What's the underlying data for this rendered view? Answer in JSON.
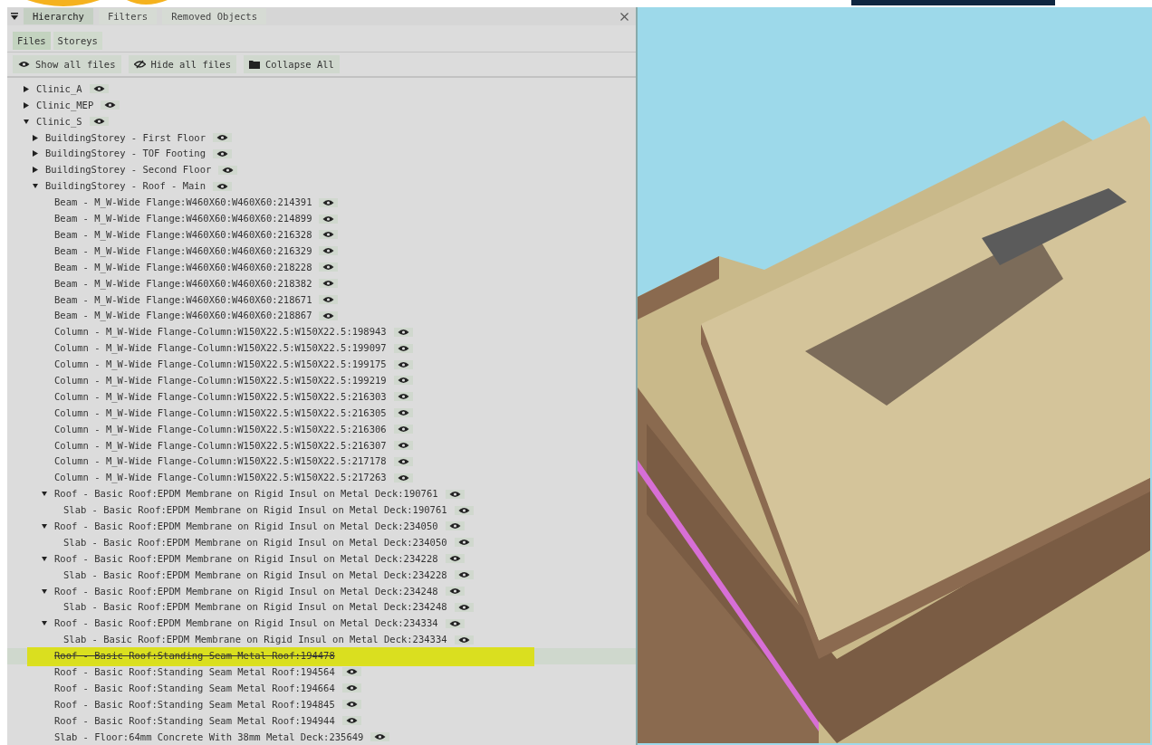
{
  "panel_tabs": [
    {
      "label": "Hierarchy",
      "selected": true
    },
    {
      "label": "Filters",
      "selected": false
    },
    {
      "label": "Removed Objects",
      "selected": false
    }
  ],
  "view_tabs": [
    {
      "label": "Files",
      "selected": true
    },
    {
      "label": "Storeys",
      "selected": false
    }
  ],
  "actions": [
    {
      "kind": "show",
      "label": "Show all files"
    },
    {
      "kind": "hide",
      "label": "Hide all files"
    },
    {
      "kind": "collapse",
      "label": "Collapse All"
    }
  ],
  "tree": [
    {
      "label": "Clinic_A",
      "expanded": false,
      "visible": true
    },
    {
      "label": "Clinic_MEP",
      "expanded": false,
      "visible": true
    },
    {
      "label": "Clinic_S",
      "expanded": true,
      "visible": true,
      "children": [
        {
          "label": "BuildingStorey - First Floor",
          "expanded": false,
          "visible": true
        },
        {
          "label": "BuildingStorey - TOF Footing",
          "expanded": false,
          "visible": true
        },
        {
          "label": "BuildingStorey - Second Floor",
          "expanded": false,
          "visible": true
        },
        {
          "label": "BuildingStorey - Roof - Main",
          "expanded": true,
          "visible": true,
          "children": [
            {
              "label": "Beam - M_W-Wide Flange:W460X60:W460X60:214391",
              "visible": true
            },
            {
              "label": "Beam - M_W-Wide Flange:W460X60:W460X60:214899",
              "visible": true
            },
            {
              "label": "Beam - M_W-Wide Flange:W460X60:W460X60:216328",
              "visible": true
            },
            {
              "label": "Beam - M_W-Wide Flange:W460X60:W460X60:216329",
              "visible": true
            },
            {
              "label": "Beam - M_W-Wide Flange:W460X60:W460X60:218228",
              "visible": true
            },
            {
              "label": "Beam - M_W-Wide Flange:W460X60:W460X60:218382",
              "visible": true
            },
            {
              "label": "Beam - M_W-Wide Flange:W460X60:W460X60:218671",
              "visible": true
            },
            {
              "label": "Beam - M_W-Wide Flange:W460X60:W460X60:218867",
              "visible": true
            },
            {
              "label": "Column - M_W-Wide Flange-Column:W150X22.5:W150X22.5:198943",
              "visible": true
            },
            {
              "label": "Column - M_W-Wide Flange-Column:W150X22.5:W150X22.5:199097",
              "visible": true
            },
            {
              "label": "Column - M_W-Wide Flange-Column:W150X22.5:W150X22.5:199175",
              "visible": true
            },
            {
              "label": "Column - M_W-Wide Flange-Column:W150X22.5:W150X22.5:199219",
              "visible": true
            },
            {
              "label": "Column - M_W-Wide Flange-Column:W150X22.5:W150X22.5:216303",
              "visible": true
            },
            {
              "label": "Column - M_W-Wide Flange-Column:W150X22.5:W150X22.5:216305",
              "visible": true
            },
            {
              "label": "Column - M_W-Wide Flange-Column:W150X22.5:W150X22.5:216306",
              "visible": true
            },
            {
              "label": "Column - M_W-Wide Flange-Column:W150X22.5:W150X22.5:216307",
              "visible": true
            },
            {
              "label": "Column - M_W-Wide Flange-Column:W150X22.5:W150X22.5:217178",
              "visible": true
            },
            {
              "label": "Column - M_W-Wide Flange-Column:W150X22.5:W150X22.5:217263",
              "visible": true
            },
            {
              "label": "Roof - Basic Roof:EPDM Membrane on Rigid Insul on Metal Deck:190761",
              "expanded": true,
              "visible": true,
              "children": [
                {
                  "label": "Slab - Basic Roof:EPDM Membrane on Rigid Insul on Metal Deck:190761",
                  "visible": true
                }
              ]
            },
            {
              "label": "Roof - Basic Roof:EPDM Membrane on Rigid Insul on Metal Deck:234050",
              "expanded": true,
              "visible": true,
              "children": [
                {
                  "label": "Slab - Basic Roof:EPDM Membrane on Rigid Insul on Metal Deck:234050",
                  "visible": true
                }
              ]
            },
            {
              "label": "Roof - Basic Roof:EPDM Membrane on Rigid Insul on Metal Deck:234228",
              "expanded": true,
              "visible": true,
              "children": [
                {
                  "label": "Slab - Basic Roof:EPDM Membrane on Rigid Insul on Metal Deck:234228",
                  "visible": true
                }
              ]
            },
            {
              "label": "Roof - Basic Roof:EPDM Membrane on Rigid Insul on Metal Deck:234248",
              "expanded": true,
              "visible": true,
              "children": [
                {
                  "label": "Slab - Basic Roof:EPDM Membrane on Rigid Insul on Metal Deck:234248",
                  "visible": true
                }
              ]
            },
            {
              "label": "Roof - Basic Roof:EPDM Membrane on Rigid Insul on Metal Deck:234334",
              "expanded": true,
              "visible": true,
              "children": [
                {
                  "label": "Slab - Basic Roof:EPDM Membrane on Rigid Insul on Metal Deck:234334",
                  "visible": true
                }
              ]
            },
            {
              "label": "Roof - Basic Roof:Standing Seam Metal Roof:194478",
              "visible": false,
              "selected": true,
              "highlighted": true
            },
            {
              "label": "Roof - Basic Roof:Standing Seam Metal Roof:194564",
              "visible": true
            },
            {
              "label": "Roof - Basic Roof:Standing Seam Metal Roof:194664",
              "visible": true
            },
            {
              "label": "Roof - Basic Roof:Standing Seam Metal Roof:194845",
              "visible": true
            },
            {
              "label": "Roof - Basic Roof:Standing Seam Metal Roof:194944",
              "visible": true
            },
            {
              "label": "Slab - Floor:64mm Concrete With 38mm Metal Deck:235649",
              "visible": true
            }
          ]
        }
      ]
    }
  ]
}
